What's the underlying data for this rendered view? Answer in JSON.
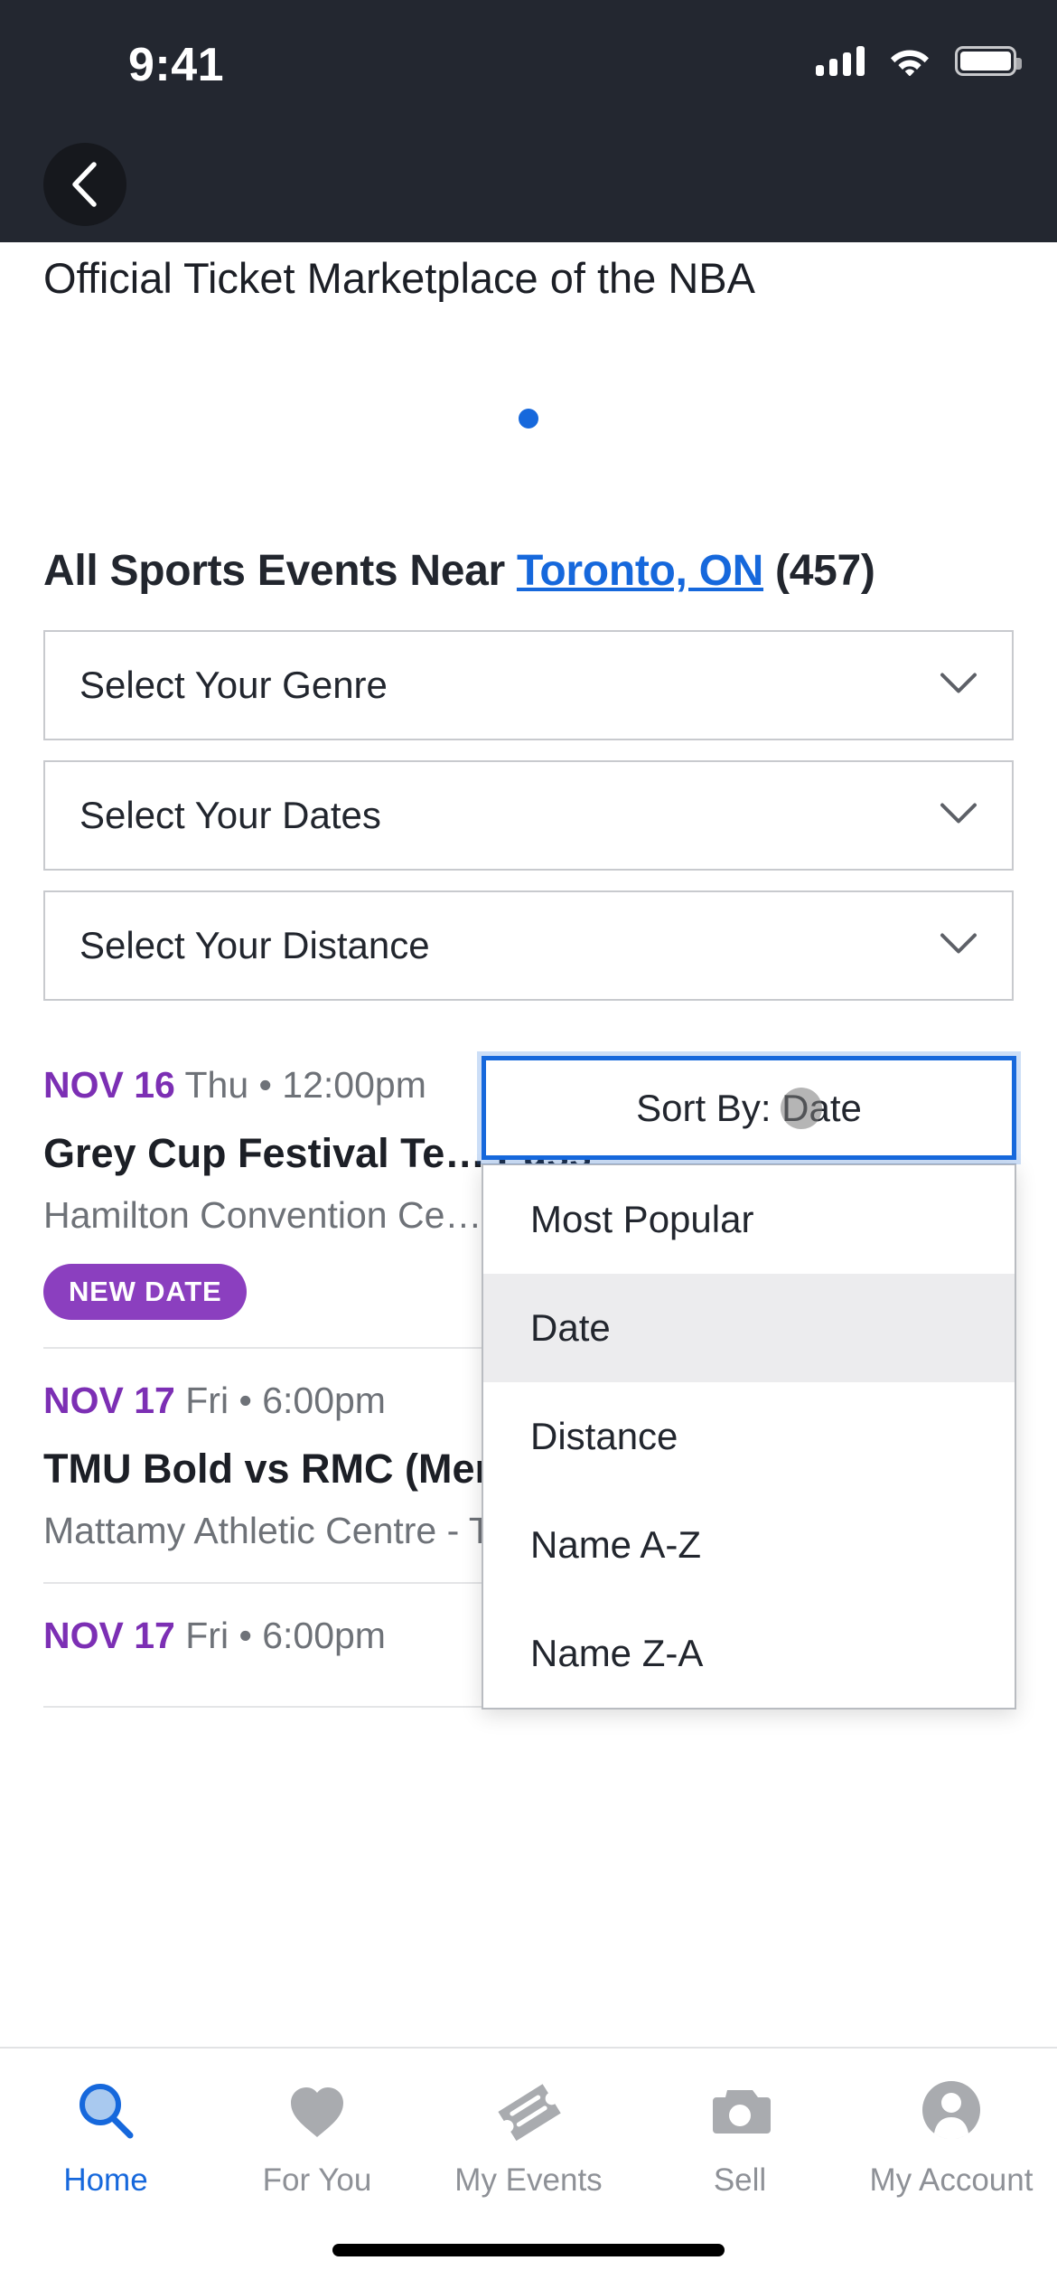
{
  "status_bar": {
    "time": "9:41",
    "signal_icon": "cellular-signal-icon",
    "wifi_icon": "wifi-icon",
    "battery_icon": "battery-icon"
  },
  "header": {
    "back_icon": "chevron-left-icon"
  },
  "promo": {
    "text": "Official Ticket Marketplace of the NBA",
    "dot_color": "#1668dc",
    "dots": 1
  },
  "section": {
    "title_prefix": "All Sports Events Near ",
    "location_link": "Toronto, ON",
    "count": " (457)"
  },
  "filters": [
    {
      "label": "Select Your Genre",
      "icon": "chevron-down-icon"
    },
    {
      "label": "Select Your Dates",
      "icon": "chevron-down-icon"
    },
    {
      "label": "Select Your Distance",
      "icon": "chevron-down-icon"
    }
  ],
  "sort": {
    "button_label": "Sort By: Date",
    "expanded": true,
    "focus_color": "#1668dc",
    "options": [
      {
        "label": "Most Popular",
        "selected": false
      },
      {
        "label": "Date",
        "selected": true
      },
      {
        "label": "Distance",
        "selected": false
      },
      {
        "label": "Name A-Z",
        "selected": false
      },
      {
        "label": "Name Z-A",
        "selected": false
      }
    ]
  },
  "events": [
    {
      "date": "NOV 16",
      "when": "Thu • 12:00pm",
      "title": "Grey Cup Festival Te… Pass",
      "venue": "Hamilton Convention Ce… Canada",
      "badge": "NEW DATE",
      "badge_color": "#8b3fbf"
    },
    {
      "date": "NOV 17",
      "when": "Fri • 6:00pm",
      "title": "TMU Bold vs RMC (Men's & Women's Volleyball)",
      "venue": "Mattamy Athletic Centre - Toronto, Canada",
      "badge": "",
      "badge_color": ""
    },
    {
      "date": "NOV 17",
      "when": "Fri • 6:00pm",
      "title": "",
      "venue": "",
      "badge": "",
      "badge_color": ""
    }
  ],
  "tabbar": {
    "items": [
      {
        "label": "Home",
        "icon": "search-icon",
        "active": true
      },
      {
        "label": "For You",
        "icon": "heart-icon",
        "active": false
      },
      {
        "label": "My Events",
        "icon": "ticket-icon",
        "active": false
      },
      {
        "label": "Sell",
        "icon": "camera-icon",
        "active": false
      },
      {
        "label": "My Account",
        "icon": "person-icon",
        "active": false
      }
    ],
    "active_color": "#1668dc",
    "inactive_color": "#8e9197"
  }
}
